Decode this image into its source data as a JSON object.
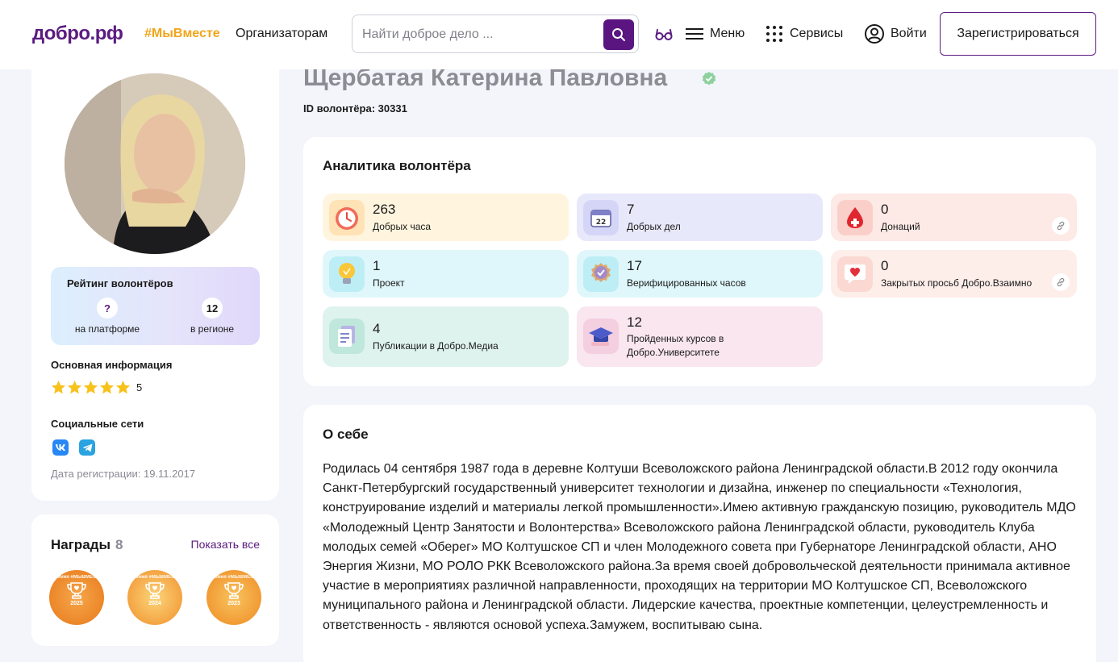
{
  "header": {
    "logo": "добро.рф",
    "tag_link": "#МыВместе",
    "organizers_link": "Организаторам",
    "search": {
      "placeholder": "Найти доброе дело ...",
      "value": ""
    },
    "menu_label": "Меню",
    "services_label": "Сервисы",
    "login_label": "Войти",
    "register_label": "Зарегистрироваться",
    "accent_color": "#5b1580"
  },
  "profile": {
    "name": "Щербатая Катерина Павловна",
    "volunteer_id_label": "ID волонтёра:",
    "volunteer_id": "30331",
    "rating": {
      "title": "Рейтинг волонтёров",
      "platform_value": "?",
      "platform_label": "на платформе",
      "region_value": "12",
      "region_label": "в регионе"
    },
    "basic_info_title": "Основная информация",
    "stars_value": 5,
    "stars_label": "5",
    "social_title": "Социальные сети",
    "social_networks": [
      "vk-icon",
      "telegram-icon"
    ],
    "registration_date": "Дата регистрации: 19.11.2017"
  },
  "awards": {
    "title": "Награды",
    "count": "8",
    "show_all": "Показать все",
    "items": [
      {
        "title": "Премия #МЫВМЕСТЕ",
        "year": "2025",
        "color": "#ef8a1d"
      },
      {
        "title": "Премия #МЫВМЕСТЕ",
        "year": "2024",
        "color": "#f5a623"
      },
      {
        "title": "Премия #МЫВМЕСТЕ",
        "year": "2023",
        "color": "#f49a1e"
      }
    ]
  },
  "analytics": {
    "title": "Аналитика волонтёра",
    "stats": [
      {
        "value": "263",
        "label": "Добрых часа",
        "icon": "clock-icon",
        "bg": "#fff5de"
      },
      {
        "value": "7",
        "label": "Добрых дел",
        "icon": "calendar-icon",
        "bg": "#e8e8fb"
      },
      {
        "value": "0",
        "label": "Донаций",
        "icon": "blood-drop-icon",
        "bg": "#fde9e6"
      },
      {
        "value": "1",
        "label": "Проект",
        "icon": "lightbulb-icon",
        "bg": "#dff7fb"
      },
      {
        "value": "17",
        "label": "Верифицированных часов",
        "icon": "verified-badge-icon",
        "bg": "#dff7fb"
      },
      {
        "value": "0",
        "label": "Закрытых просьб Добро.Взаимно",
        "icon": "heart-bubble-icon",
        "bg": "#fdeeea"
      },
      {
        "value": "4",
        "label": "Публикации в Добро.Медиа",
        "icon": "documents-icon",
        "bg": "#dff3ee"
      },
      {
        "value": "12",
        "label": "Пройденных курсов в Добро.Университете",
        "icon": "graduation-cap-icon",
        "bg": "#f9e6ef"
      }
    ]
  },
  "about": {
    "title": "О себе",
    "text": "Родилась 04 сентября 1987 года в деревне Колтуши Всеволожского района Ленинградской области.В 2012 году окончила Санкт-Петербургский государственный университет технологии и дизайна, инженер по специальности «Технология, конструирование изделий и материалы легкой промышленности».Имею активную гражданскую позицию, руководитель МДО «Молодежный Центр Занятости и Волонтерства» Всеволожского района Ленинградской области, руководитель Клуба молодых семей «Оберег» МО Колтушское СП и член Молодежного совета при Губернаторе Ленинградской области, АНО Энергия Жизни, МО РОЛО РКК Всеволожского района.За время своей добровольческой деятельности принимала активное участие в мероприятиях различной направленности, проходящих на территории МО Колтушское СП, Всеволожского муниципального района и Ленинградской области. Лидерские качества, проектные компетенции, целеустремленность и ответственность - являются основой успеха.Замужем, воспитываю сына."
  }
}
